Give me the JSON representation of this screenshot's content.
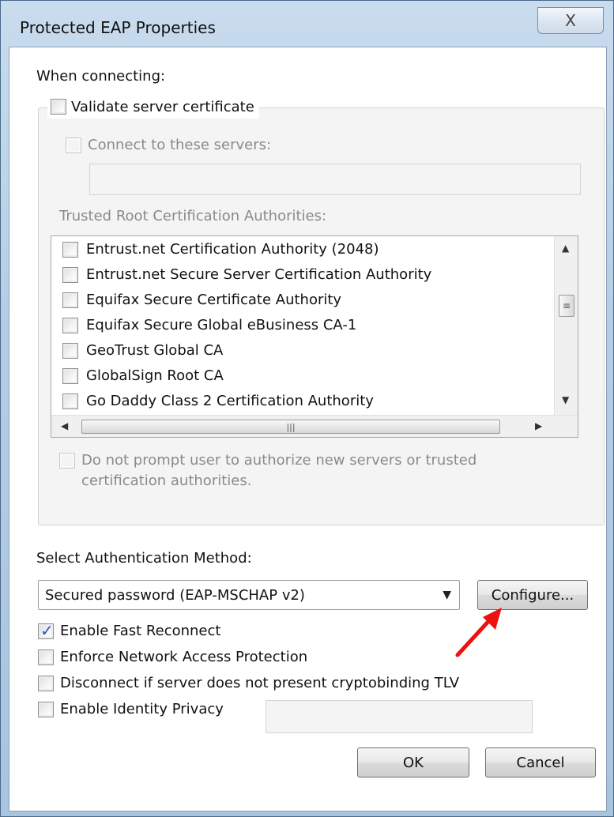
{
  "window": {
    "title": "Protected EAP Properties",
    "close_glyph": "X"
  },
  "when_connecting": "When connecting:",
  "validate_server_certificate": {
    "label": "Validate server certificate",
    "checked": false
  },
  "connect_to_servers": {
    "label": "Connect to these servers:",
    "checked": false,
    "value": ""
  },
  "trusted_root_label": "Trusted Root Certification Authorities:",
  "trusted_roots": [
    {
      "label": "Entrust.net Certification Authority (2048)",
      "checked": false
    },
    {
      "label": "Entrust.net Secure Server Certification Authority",
      "checked": false
    },
    {
      "label": "Equifax Secure Certificate Authority",
      "checked": false
    },
    {
      "label": "Equifax Secure Global eBusiness CA-1",
      "checked": false
    },
    {
      "label": "GeoTrust Global CA",
      "checked": false
    },
    {
      "label": "GlobalSign Root CA",
      "checked": false
    },
    {
      "label": "Go Daddy Class 2 Certification Authority",
      "checked": false
    }
  ],
  "do_not_prompt": {
    "line1": "Do not prompt user to authorize new servers or trusted",
    "line2": "certification authorities.",
    "checked": false
  },
  "auth_method_label": "Select Authentication Method:",
  "auth_method_value": "Secured password (EAP-MSCHAP v2)",
  "configure_button": "Configure...",
  "options": {
    "enable_fast_reconnect": {
      "label": "Enable Fast Reconnect",
      "checked": true
    },
    "enforce_nap": {
      "label": "Enforce Network Access Protection",
      "checked": false
    },
    "disconnect_no_tlv": {
      "label": "Disconnect if server does not present cryptobinding TLV",
      "checked": false
    },
    "enable_identity_privacy": {
      "label": "Enable Identity Privacy",
      "checked": false,
      "value": ""
    }
  },
  "ok_button": "OK",
  "cancel_button": "Cancel",
  "colors": {
    "annotation_arrow": "#ee1111",
    "check_mark": "#2a55b8"
  }
}
